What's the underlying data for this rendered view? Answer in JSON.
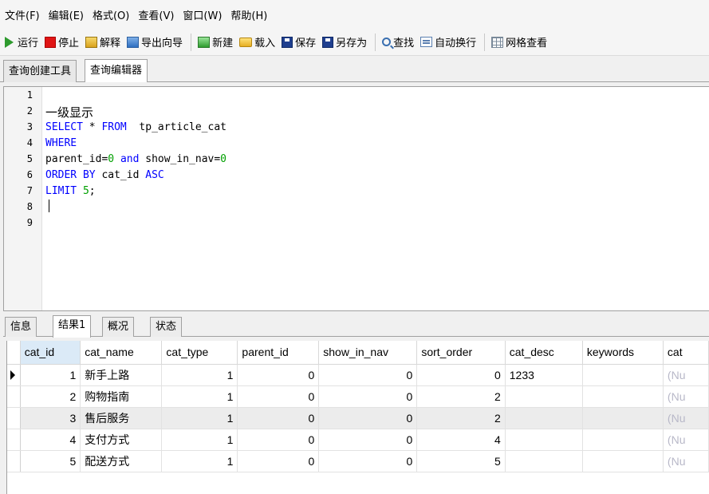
{
  "menu": [
    "文件(F)",
    "编辑(E)",
    "格式(O)",
    "查看(V)",
    "窗口(W)",
    "帮助(H)"
  ],
  "toolbar": {
    "run": "运行",
    "stop": "停止",
    "explain": "解释",
    "export_wizard": "导出向导",
    "new": "新建",
    "load": "载入",
    "save": "保存",
    "save_as": "另存为",
    "find": "查找",
    "word_wrap": "自动换行",
    "grid_view": "网格查看"
  },
  "query_tabs": [
    "查询创建工具",
    "查询编辑器"
  ],
  "editor": {
    "line_numbers": [
      "1",
      "2",
      "3",
      "4",
      "5",
      "6",
      "7",
      "8",
      "9"
    ],
    "lines": [
      {
        "parts": []
      },
      {
        "parts": [
          {
            "t": "一级显示",
            "c": "cn"
          }
        ]
      },
      {
        "parts": [
          {
            "t": "SELECT",
            "c": "kw"
          },
          {
            "t": " * ",
            "c": ""
          },
          {
            "t": "FROM",
            "c": "kw"
          },
          {
            "t": "  tp_article_cat",
            "c": ""
          }
        ]
      },
      {
        "parts": [
          {
            "t": "WHERE",
            "c": "kw"
          }
        ]
      },
      {
        "parts": [
          {
            "t": "parent_id=",
            "c": ""
          },
          {
            "t": "0",
            "c": "num"
          },
          {
            "t": " ",
            "c": ""
          },
          {
            "t": "and",
            "c": "kw"
          },
          {
            "t": " show_in_nav=",
            "c": ""
          },
          {
            "t": "0",
            "c": "num"
          }
        ]
      },
      {
        "parts": [
          {
            "t": "ORDER BY",
            "c": "kw"
          },
          {
            "t": " cat_id ",
            "c": ""
          },
          {
            "t": "ASC",
            "c": "kw"
          }
        ]
      },
      {
        "parts": [
          {
            "t": "LIMIT",
            "c": "kw"
          },
          {
            "t": " ",
            "c": ""
          },
          {
            "t": "5",
            "c": "num"
          },
          {
            "t": ";",
            "c": ""
          }
        ]
      },
      {
        "parts": []
      },
      {
        "parts": []
      }
    ]
  },
  "result_tabs": [
    "信息",
    "结果1",
    "概况",
    "状态"
  ],
  "result_table": {
    "columns": [
      "cat_id",
      "cat_name",
      "cat_type",
      "parent_id",
      "show_in_nav",
      "sort_order",
      "cat_desc",
      "keywords",
      "cat"
    ],
    "null_text": "(Nu",
    "rows": [
      [
        "1",
        "新手上路",
        "1",
        "0",
        "0",
        "0",
        "1233",
        "",
        "(Nu"
      ],
      [
        "2",
        "购物指南",
        "1",
        "0",
        "0",
        "2",
        "",
        "",
        "(Nu"
      ],
      [
        "3",
        "售后服务",
        "1",
        "0",
        "0",
        "2",
        "",
        "",
        "(Nu"
      ],
      [
        "4",
        "支付方式",
        "1",
        "0",
        "0",
        "4",
        "",
        "",
        "(Nu"
      ],
      [
        "5",
        "配送方式",
        "1",
        "0",
        "0",
        "5",
        "",
        "",
        "(Nu"
      ]
    ]
  }
}
